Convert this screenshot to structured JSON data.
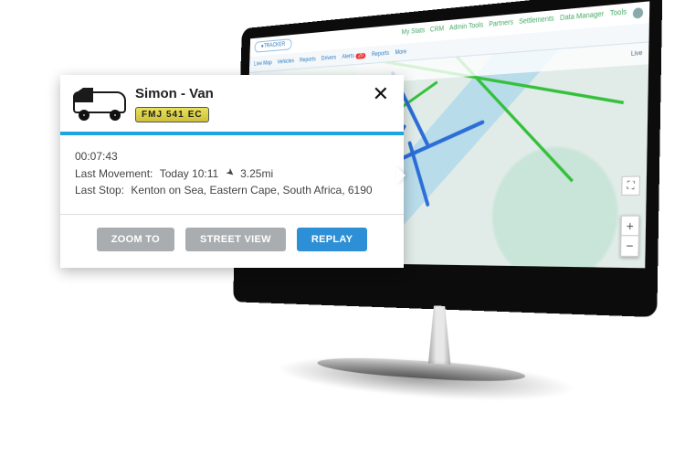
{
  "app": {
    "logo_text": "●TRACKER",
    "top_menu": [
      "My Stats",
      "CRM",
      "Admin Tools",
      "Partners",
      "Settlements",
      "Data Manager",
      "Tools"
    ],
    "nav": {
      "items": [
        "Live Map",
        "Vehicles",
        "Reports",
        "Drivers",
        "Alerts"
      ],
      "alert_count": "20",
      "extra": [
        "Reports",
        "More"
      ]
    },
    "toolbar": {
      "left_label": "Map",
      "status": "Live"
    }
  },
  "map": {
    "provider": "Google",
    "zoom_in": "+",
    "zoom_out": "−",
    "fullscreen_glyph": "⛶"
  },
  "popup": {
    "vehicle_name": "Simon - Van",
    "plate_parts": [
      "FMJ",
      "541",
      "EC"
    ],
    "duration": "00:07:43",
    "last_movement_label": "Last Movement:",
    "last_movement_time": "Today 10:11",
    "distance": "3.25mi",
    "last_stop_label": "Last Stop:",
    "last_stop_value": "Kenton on Sea, Eastern Cape, South Africa, 6190",
    "actions": {
      "zoom": "ZOOM TO",
      "street": "STREET VIEW",
      "replay": "REPLAY"
    },
    "close_glyph": "✕"
  }
}
